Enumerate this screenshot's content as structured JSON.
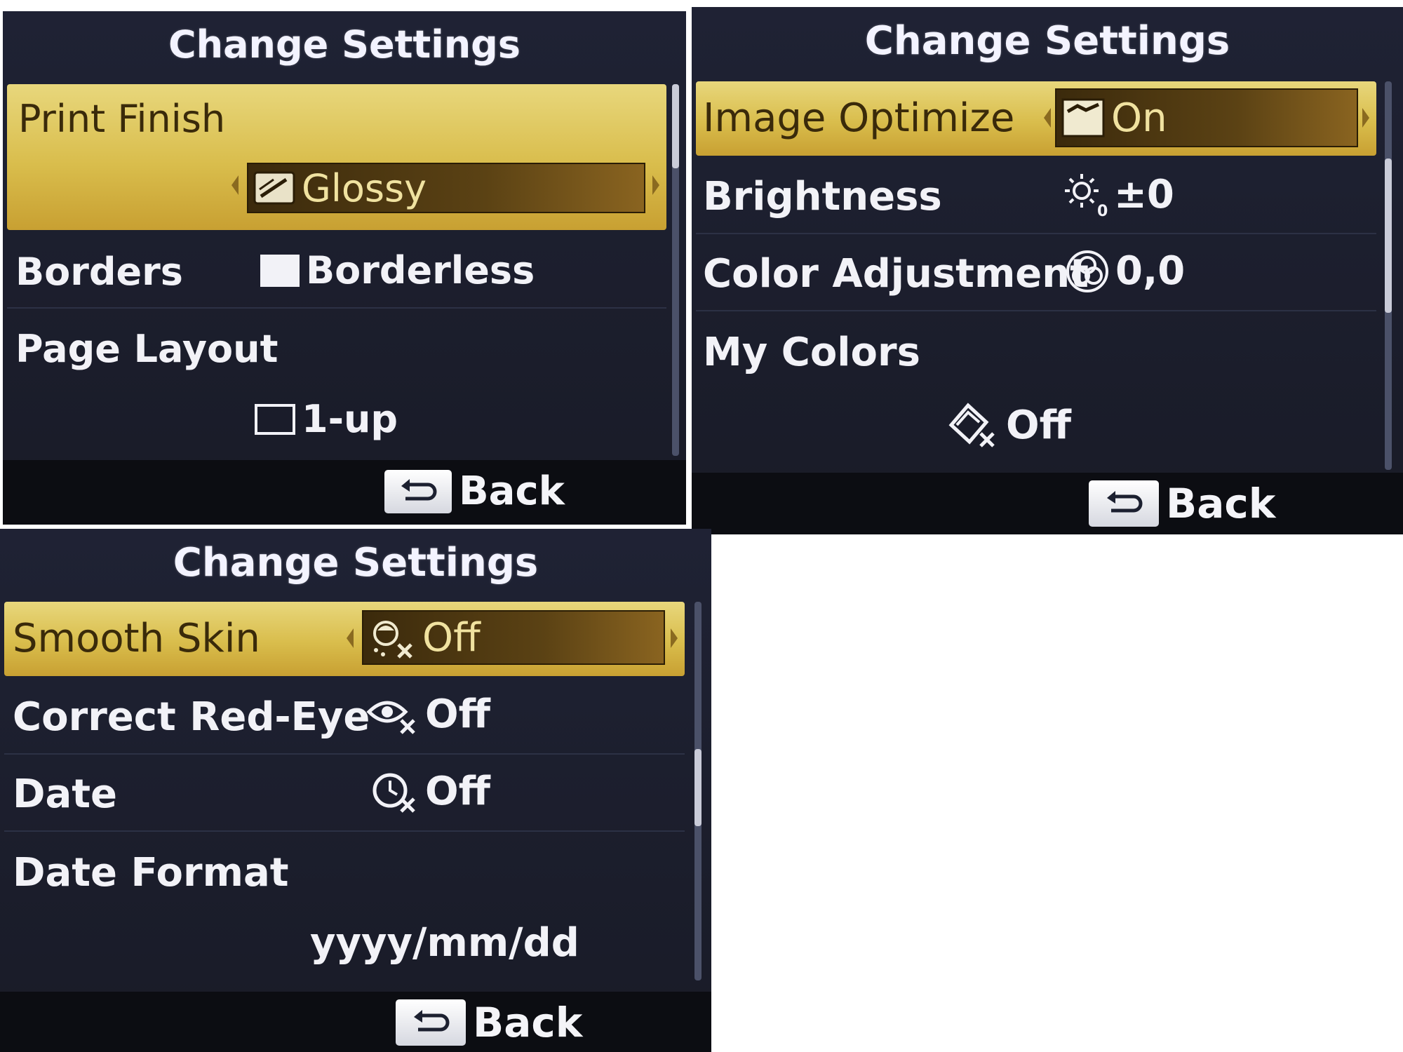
{
  "panel1": {
    "title": "Change Settings",
    "rows": [
      {
        "label": "Print Finish",
        "value": "Glossy",
        "icon": "glossy-paper-icon"
      },
      {
        "label": "Borders",
        "value": "Borderless",
        "icon": "borderless-icon"
      },
      {
        "label": "Page Layout",
        "value": "1-up",
        "icon": "single-frame-icon"
      }
    ],
    "back": "Back"
  },
  "panel2": {
    "title": "Change Settings",
    "rows": [
      {
        "label": "Image Optimize",
        "value": "On",
        "icon": "image-optimize-icon"
      },
      {
        "label": "Brightness",
        "value": "±0",
        "icon": "brightness-icon"
      },
      {
        "label": "Color Adjustment",
        "value": "0,0",
        "icon": "color-adjust-icon"
      },
      {
        "label": "My Colors",
        "value": "Off",
        "icon": "my-colors-off-icon"
      }
    ],
    "back": "Back"
  },
  "panel3": {
    "title": "Change Settings",
    "rows": [
      {
        "label": "Smooth Skin",
        "value": "Off",
        "icon": "smooth-skin-off-icon"
      },
      {
        "label": "Correct Red-Eye",
        "value": "Off",
        "icon": "red-eye-off-icon"
      },
      {
        "label": "Date",
        "value": "Off",
        "icon": "date-off-icon"
      },
      {
        "label": "Date Format",
        "value": "yyyy/mm/dd"
      }
    ],
    "back": "Back"
  },
  "colors": {
    "highlight": "#d9bd4c",
    "panel_bg": "#1c1f2e",
    "text": "#f2f2f7"
  }
}
